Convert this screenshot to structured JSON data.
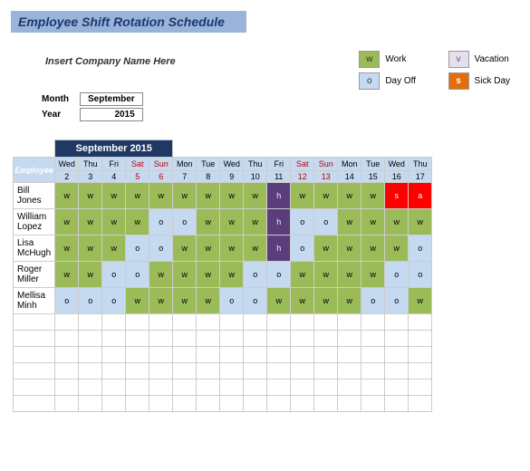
{
  "title": "Employee Shift Rotation Schedule",
  "company_prompt": "Insert Company Name Here",
  "meta": {
    "month_label": "Month",
    "month_value": "September",
    "year_label": "Year",
    "year_value": "2015"
  },
  "legend": {
    "work": {
      "code": "w",
      "label": "Work"
    },
    "off": {
      "code": "o",
      "label": "Day Off"
    },
    "vacation": {
      "code": "v",
      "label": "Vacation"
    },
    "sick": {
      "code": "s",
      "label": "Sick Day"
    }
  },
  "calendar": {
    "banner": "September 2015",
    "days": [
      {
        "dow": "Wed",
        "num": "2",
        "wk": false
      },
      {
        "dow": "Thu",
        "num": "3",
        "wk": false
      },
      {
        "dow": "Fri",
        "num": "4",
        "wk": false
      },
      {
        "dow": "Sat",
        "num": "5",
        "wk": true
      },
      {
        "dow": "Sun",
        "num": "6",
        "wk": true
      },
      {
        "dow": "Mon",
        "num": "7",
        "wk": false
      },
      {
        "dow": "Tue",
        "num": "8",
        "wk": false
      },
      {
        "dow": "Wed",
        "num": "9",
        "wk": false
      },
      {
        "dow": "Thu",
        "num": "10",
        "wk": false
      },
      {
        "dow": "Fri",
        "num": "11",
        "wk": false
      },
      {
        "dow": "Sat",
        "num": "12",
        "wk": true
      },
      {
        "dow": "Sun",
        "num": "13",
        "wk": true
      },
      {
        "dow": "Mon",
        "num": "14",
        "wk": false
      },
      {
        "dow": "Tue",
        "num": "15",
        "wk": false
      },
      {
        "dow": "Wed",
        "num": "16",
        "wk": false
      },
      {
        "dow": "Thu",
        "num": "17",
        "wk": false
      }
    ],
    "employee_header": "Employee"
  },
  "employees": [
    {
      "name": "Bill Jones",
      "shifts": [
        "w",
        "w",
        "w",
        "w",
        "w",
        "w",
        "w",
        "w",
        "w",
        "h",
        "w",
        "w",
        "w",
        "w",
        "s",
        "a"
      ]
    },
    {
      "name": "William Lopez",
      "shifts": [
        "w",
        "w",
        "w",
        "w",
        "o",
        "o",
        "w",
        "w",
        "w",
        "h",
        "o",
        "o",
        "w",
        "w",
        "w",
        "w"
      ]
    },
    {
      "name": "Lisa McHugh",
      "shifts": [
        "w",
        "w",
        "w",
        "o",
        "o",
        "w",
        "w",
        "w",
        "w",
        "h",
        "o",
        "w",
        "w",
        "w",
        "w",
        "o"
      ]
    },
    {
      "name": "Roger Miller",
      "shifts": [
        "w",
        "w",
        "o",
        "o",
        "w",
        "w",
        "w",
        "w",
        "o",
        "o",
        "w",
        "w",
        "w",
        "w",
        "o",
        "o"
      ]
    },
    {
      "name": "Mellisa Minh",
      "shifts": [
        "o",
        "o",
        "o",
        "w",
        "w",
        "w",
        "w",
        "o",
        "o",
        "w",
        "w",
        "w",
        "w",
        "o",
        "o",
        "w"
      ]
    }
  ],
  "blank_rows": 6
}
